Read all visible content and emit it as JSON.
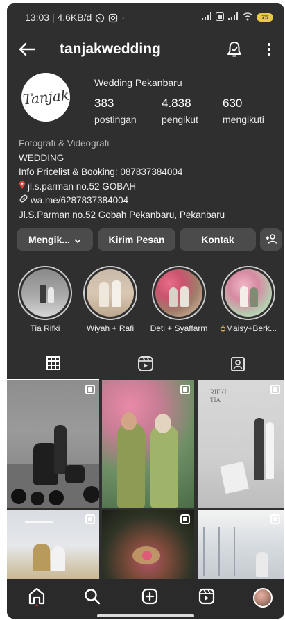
{
  "status_bar": {
    "time_info": "13:03 | 4,6KB/d",
    "battery": "75"
  },
  "header": {
    "username": "tanjakwedding"
  },
  "profile": {
    "avatar_text": "Tanjak",
    "category": "Wedding Pekanbaru",
    "stats": [
      {
        "value": "383",
        "label": "postingan"
      },
      {
        "value": "4.838",
        "label": "pengikut"
      },
      {
        "value": "630",
        "label": "mengikuti"
      }
    ]
  },
  "bio": {
    "category_label": "Fotografi & Videografi",
    "line1": "WEDDING",
    "line2": "Info Pricelist & Booking: 087837384004",
    "line3": "jl.s.parman no.52 GOBAH",
    "link": "wa.me/6287837384004",
    "address": "Jl.S.Parman no.52 Gobah Pekanbaru, Pekanbaru"
  },
  "buttons": {
    "following": "Mengik...",
    "message": "Kirim Pesan",
    "contact": "Kontak"
  },
  "highlights": [
    {
      "label": "Tia Rifki"
    },
    {
      "label": "Wiyah + Rafi"
    },
    {
      "label": "Deti + Syaffarm"
    },
    {
      "label": "Maisy+Berk..."
    }
  ],
  "posts": {
    "overlay_text": "RIFKI\nTIA"
  },
  "colors": {
    "background": "#2f2f2f",
    "button": "#4b4b4b",
    "text": "#ffffff",
    "battery": "#e8c94a"
  }
}
